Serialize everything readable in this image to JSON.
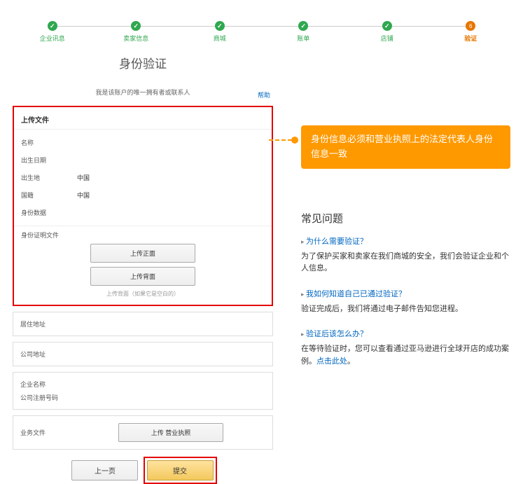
{
  "stepper": {
    "steps": [
      {
        "label": "企业讯息"
      },
      {
        "label": "卖家信息"
      },
      {
        "label": "商城"
      },
      {
        "label": "账单"
      },
      {
        "label": "店铺"
      },
      {
        "label": "验证"
      }
    ]
  },
  "page": {
    "title": "身份验证",
    "subtitle": "我是该账户的唯一拥有者或联系人",
    "help": "帮助"
  },
  "upload": {
    "section_title": "上传文件",
    "fields": {
      "name": "名称",
      "dob": "出生日期",
      "birthplace": "出生地",
      "birthplace_value": "中国",
      "nationality": "国籍",
      "nationality_value": "中国",
      "id_data": "身份数据"
    },
    "id_doc_label": "身份证明文件",
    "btn_front": "上传正面",
    "btn_back": "上传背面",
    "hint": "上传背面（如果它是空白的）"
  },
  "panels": {
    "address": "居住地址",
    "company_addr": "公司地址",
    "company_name": "企业名称",
    "reg_no": "公司注册号码",
    "biz_doc": "业务文件",
    "btn_license": "上传 营业执照"
  },
  "buttons": {
    "prev": "上一页",
    "submit": "提交"
  },
  "callout": "身份信息必须和营业执照上的法定代表人身份信息一致",
  "faq": {
    "title": "常见问题",
    "items": [
      {
        "q": "为什么需要验证？",
        "a": "为了保护买家和卖家在我们商城的安全，我们会验证企业和个人信息。"
      },
      {
        "q": "我如何知道自己已通过验证？",
        "a": "验证完成后，我们将通过电子邮件告知您进程。"
      },
      {
        "q": "验证后该怎么办？",
        "a_prefix": "在等待验证时，您可以查看通过亚马逊进行全球开店的成功案例。",
        "a_link": "点击此处",
        "a_suffix": "。"
      }
    ]
  }
}
